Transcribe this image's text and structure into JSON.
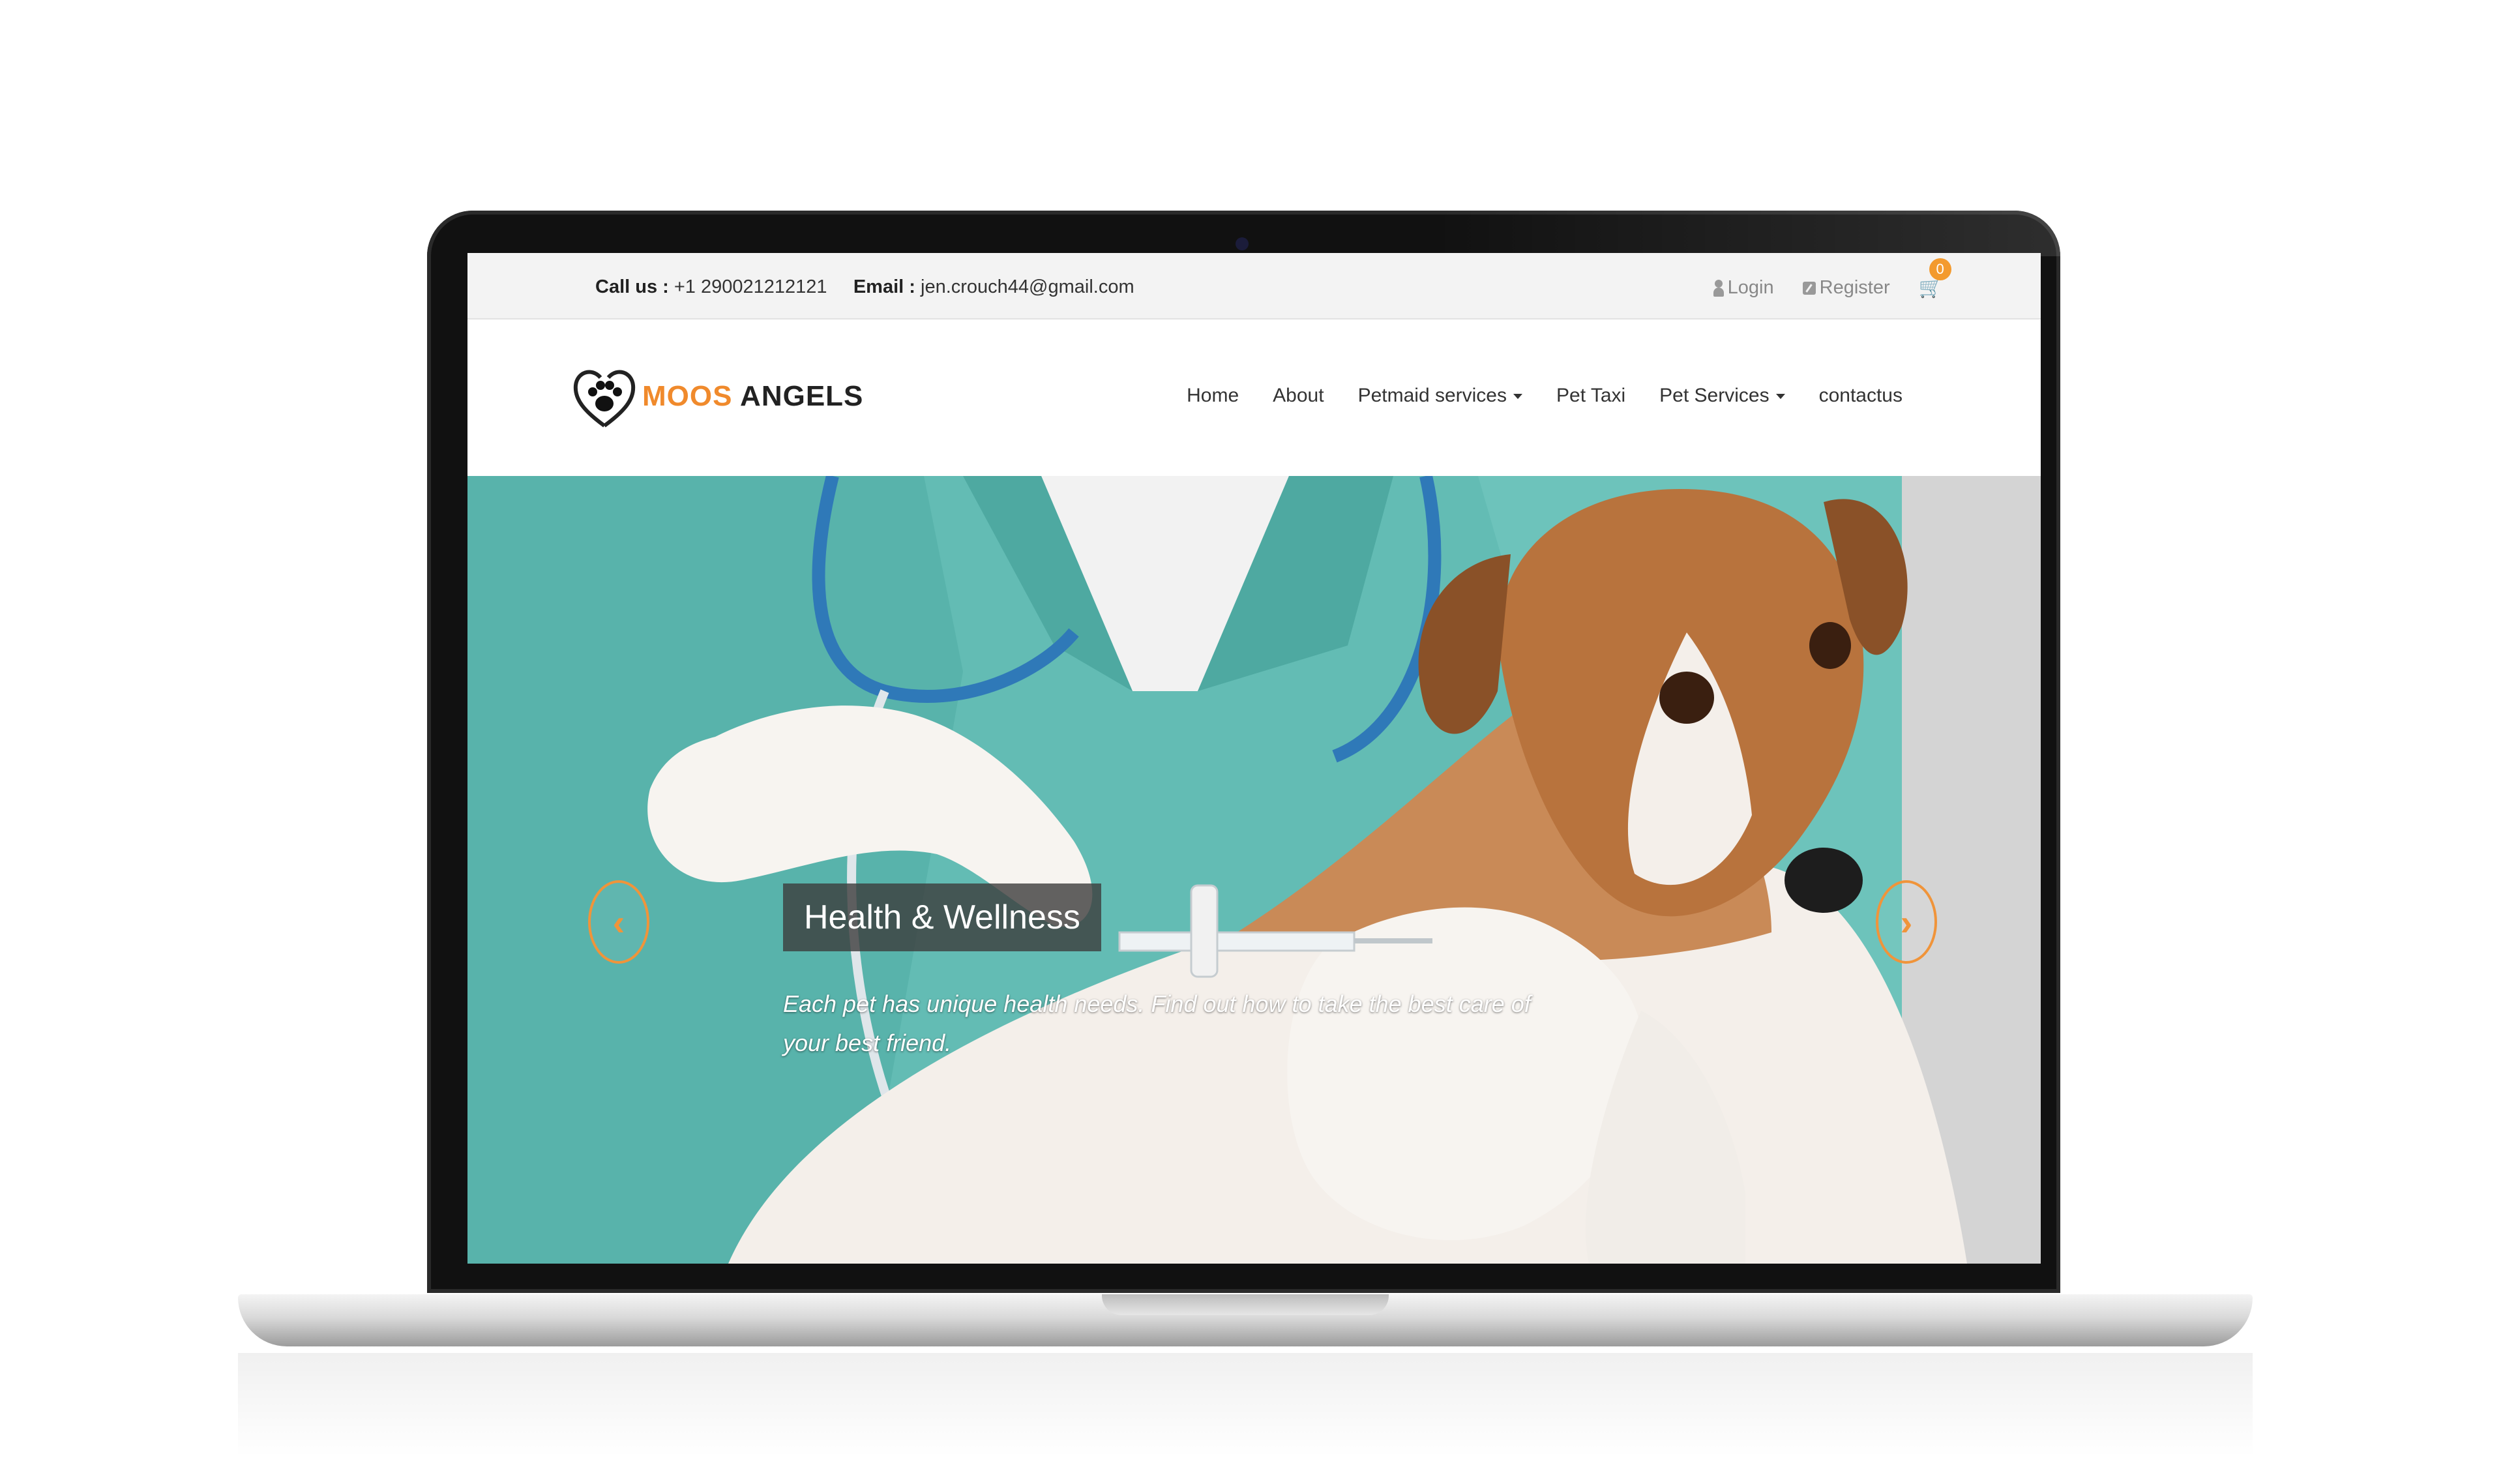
{
  "topbar": {
    "call_label": "Call us :",
    "call_value": "+1 290021212121",
    "email_label": "Email :",
    "email_value": "jen.crouch44@gmail.com",
    "login_label": "Login",
    "register_label": "Register",
    "cart_count": "0"
  },
  "logo": {
    "word1": "MOOS",
    "word2": "ANGELS"
  },
  "nav": {
    "home": "Home",
    "about": "About",
    "petmaid": "Petmaid services",
    "pet_taxi": "Pet Taxi",
    "pet_services": "Pet Services",
    "contact": "contactus"
  },
  "hero": {
    "title": "Health & Wellness",
    "text": "Each pet has unique health needs. Find out how to take the best care of your best friend.",
    "prev_glyph": "‹",
    "next_glyph": "›"
  },
  "colors": {
    "accent": "#f08a2c",
    "topbar_bg": "#f3f3f3",
    "scrubs": "#5bb7b0"
  }
}
